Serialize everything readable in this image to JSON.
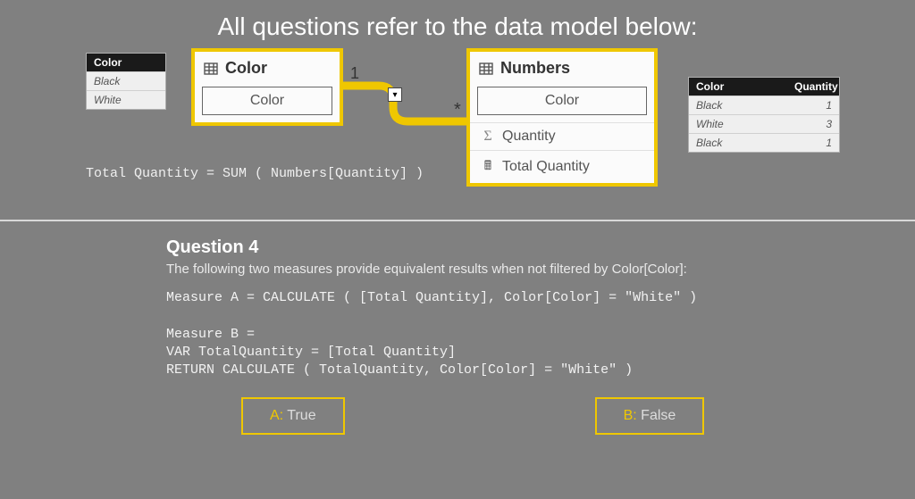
{
  "title": "All questions refer to the data model below:",
  "color_mini": {
    "header": "Color",
    "rows": [
      "Black",
      "White"
    ]
  },
  "numbers_mini": {
    "headers": {
      "color": "Color",
      "qty": "Quantity"
    },
    "rows": [
      {
        "color": "Black",
        "qty": "1"
      },
      {
        "color": "White",
        "qty": "3"
      },
      {
        "color": "Black",
        "qty": "1"
      }
    ]
  },
  "entity_color": {
    "name": "Color",
    "field": "Color"
  },
  "entity_numbers": {
    "name": "Numbers",
    "field_color": "Color",
    "field_qty": "Quantity",
    "field_total": "Total Quantity"
  },
  "relationship": {
    "one": "1",
    "many": "*"
  },
  "total_quantity_def": "Total Quantity = SUM ( Numbers[Quantity] )",
  "question": {
    "title": "Question 4",
    "prompt": "The following two measures provide equivalent results when not filtered by Color[Color]:",
    "code": "Measure A = CALCULATE ( [Total Quantity], Color[Color] = \"White\" )\n\nMeasure B =\nVAR TotalQuantity = [Total Quantity]\nRETURN CALCULATE ( TotalQuantity, Color[Color] = \"White\" )"
  },
  "answers": {
    "a": {
      "letter": "A:",
      "text": " True"
    },
    "b": {
      "letter": "B:",
      "text": " False"
    }
  }
}
